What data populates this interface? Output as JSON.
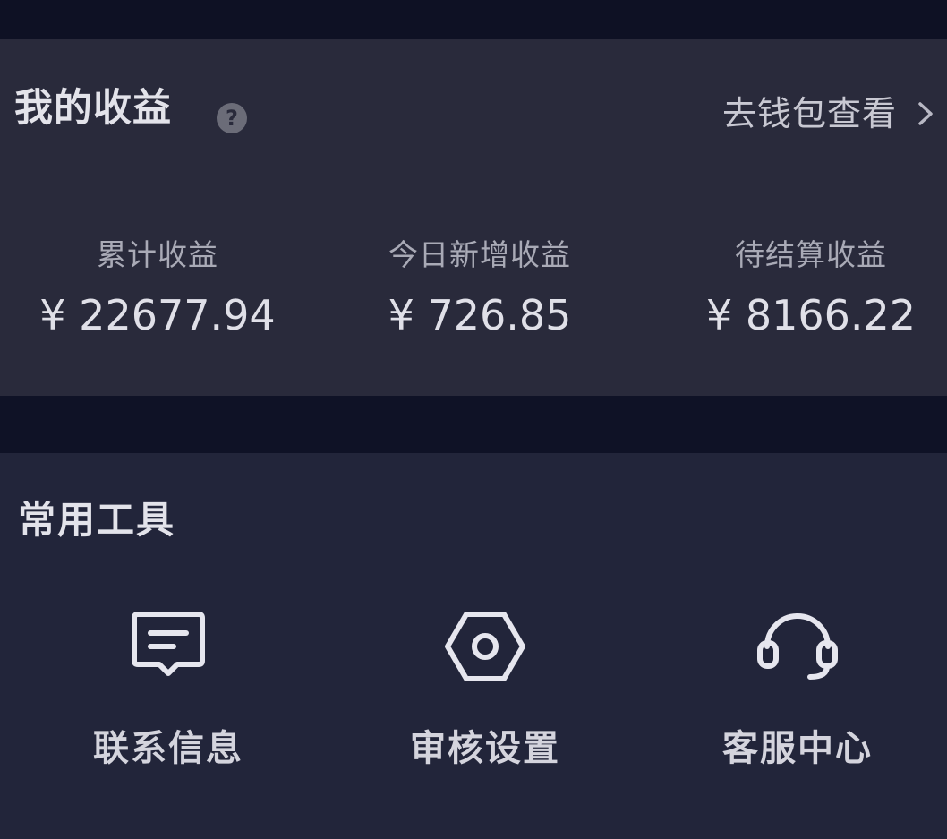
{
  "earnings": {
    "title": "我的收益",
    "help_icon": "?",
    "wallet_link": "去钱包查看",
    "stats": [
      {
        "label": "累计收益",
        "value": "¥ 22677.94"
      },
      {
        "label": "今日新增收益",
        "value": "¥ 726.85"
      },
      {
        "label": "待结算收益",
        "value": "¥ 8166.22"
      }
    ]
  },
  "tools": {
    "title": "常用工具",
    "items": [
      {
        "label": "联系信息",
        "icon": "message-icon"
      },
      {
        "label": "审核设置",
        "icon": "settings-hexagon-icon"
      },
      {
        "label": "客服中心",
        "icon": "headset-icon"
      }
    ]
  },
  "colors": {
    "background": "#0f1225",
    "earnings_card": "#292a3b",
    "tools_card": "#22253a",
    "text_primary": "#e3e3ea",
    "text_secondary": "#a9aab6"
  }
}
